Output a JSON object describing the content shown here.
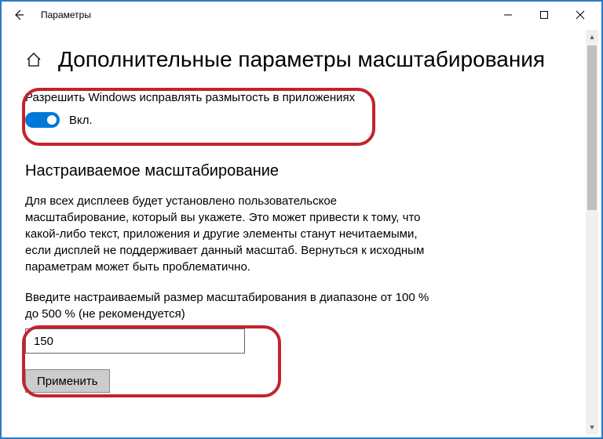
{
  "window": {
    "title": "Параметры"
  },
  "page": {
    "title": "Дополнительные параметры масштабирования",
    "fixBlur": {
      "label": "Разрешить Windows исправлять размытость в приложениях",
      "toggleText": "Вкл.",
      "on": true
    },
    "customScaling": {
      "heading": "Настраиваемое масштабирование",
      "description": "Для всех дисплеев будет установлено пользовательское масштабирование, который вы укажете. Это может привести к тому, что какой-либо текст, приложения и другие элементы станут нечитаемыми, если дисплей не поддерживает данный масштаб. Вернуться к исходным параметрам может быть проблематично.",
      "prompt": "Введите настраиваемый размер масштабирования в диапазоне от 100 % до 500 % (не рекомендуется)",
      "value": "150",
      "applyLabel": "Применить"
    }
  },
  "colors": {
    "accent": "#0078d7",
    "annot": "#c4232b"
  }
}
